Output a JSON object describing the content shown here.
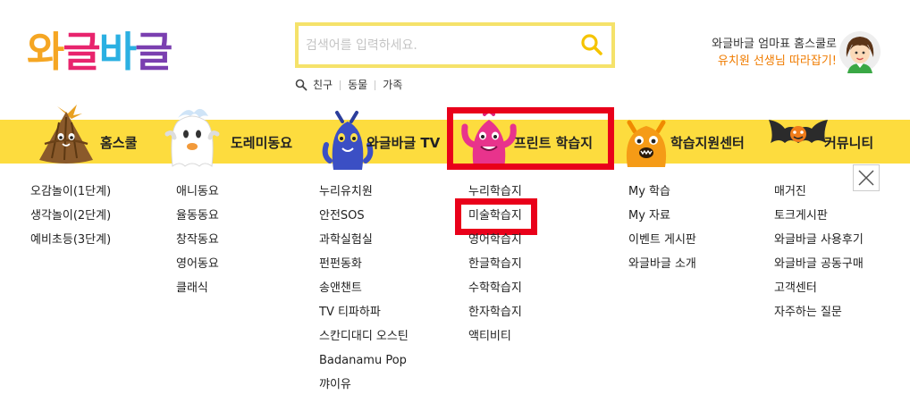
{
  "brand": {
    "logo_chars": [
      "와",
      "글",
      "바",
      "글"
    ],
    "logo_colors": [
      "#f5a623",
      "#e8246d",
      "#2bb0e2",
      "#7a3fb0"
    ]
  },
  "search": {
    "placeholder": "검색어를 입력하세요.",
    "value": "",
    "icon": "search-icon",
    "accent_color": "#f5e26a"
  },
  "quick_links": [
    "친구",
    "동물",
    "가족"
  ],
  "promo": {
    "line1": "와글바글 엄마표 홈스쿨로",
    "line2": "유치원 선생님 따라잡기!"
  },
  "nav": {
    "bar_color": "#fddc3e",
    "items": [
      {
        "label": "홈스쿨",
        "mascot": "acorn-mascot"
      },
      {
        "label": "도레미동요",
        "mascot": "ghost-mascot"
      },
      {
        "label": "와글바글 TV",
        "mascot": "blue-monster-mascot"
      },
      {
        "label": "프린트 학습지",
        "mascot": "pink-monster-mascot"
      },
      {
        "label": "학습지원센터",
        "mascot": "orange-monster-mascot"
      },
      {
        "label": "커뮤니티",
        "mascot": "bat-mascot"
      }
    ]
  },
  "highlight_color": "#e9001a",
  "menu": {
    "columns": [
      [
        "오감놀이(1단계)",
        "생각놀이(2단계)",
        "예비초등(3단계)"
      ],
      [
        "애니동요",
        "율동동요",
        "창작동요",
        "영어동요",
        "클래식"
      ],
      [
        "누리유치원",
        "안전SOS",
        "과학실험실",
        "펀펀동화",
        "송앤챈트",
        "TV 티파하파",
        "스칸디대디 오스틴",
        "Badanamu Pop",
        "꺄이유"
      ],
      [
        "누리학습지",
        "미술학습지",
        "영어학습지",
        "한글학습지",
        "수학학습지",
        "한자학습지",
        "액티비티"
      ],
      [
        "My 학습",
        "My 자료",
        "이벤트 게시판",
        "와글바글 소개"
      ],
      [
        "매거진",
        "토크게시판",
        "와글바글 사용후기",
        "와글바글 공동구매",
        "고객센터",
        "자주하는 질문"
      ]
    ]
  },
  "close_icon": "close-icon"
}
